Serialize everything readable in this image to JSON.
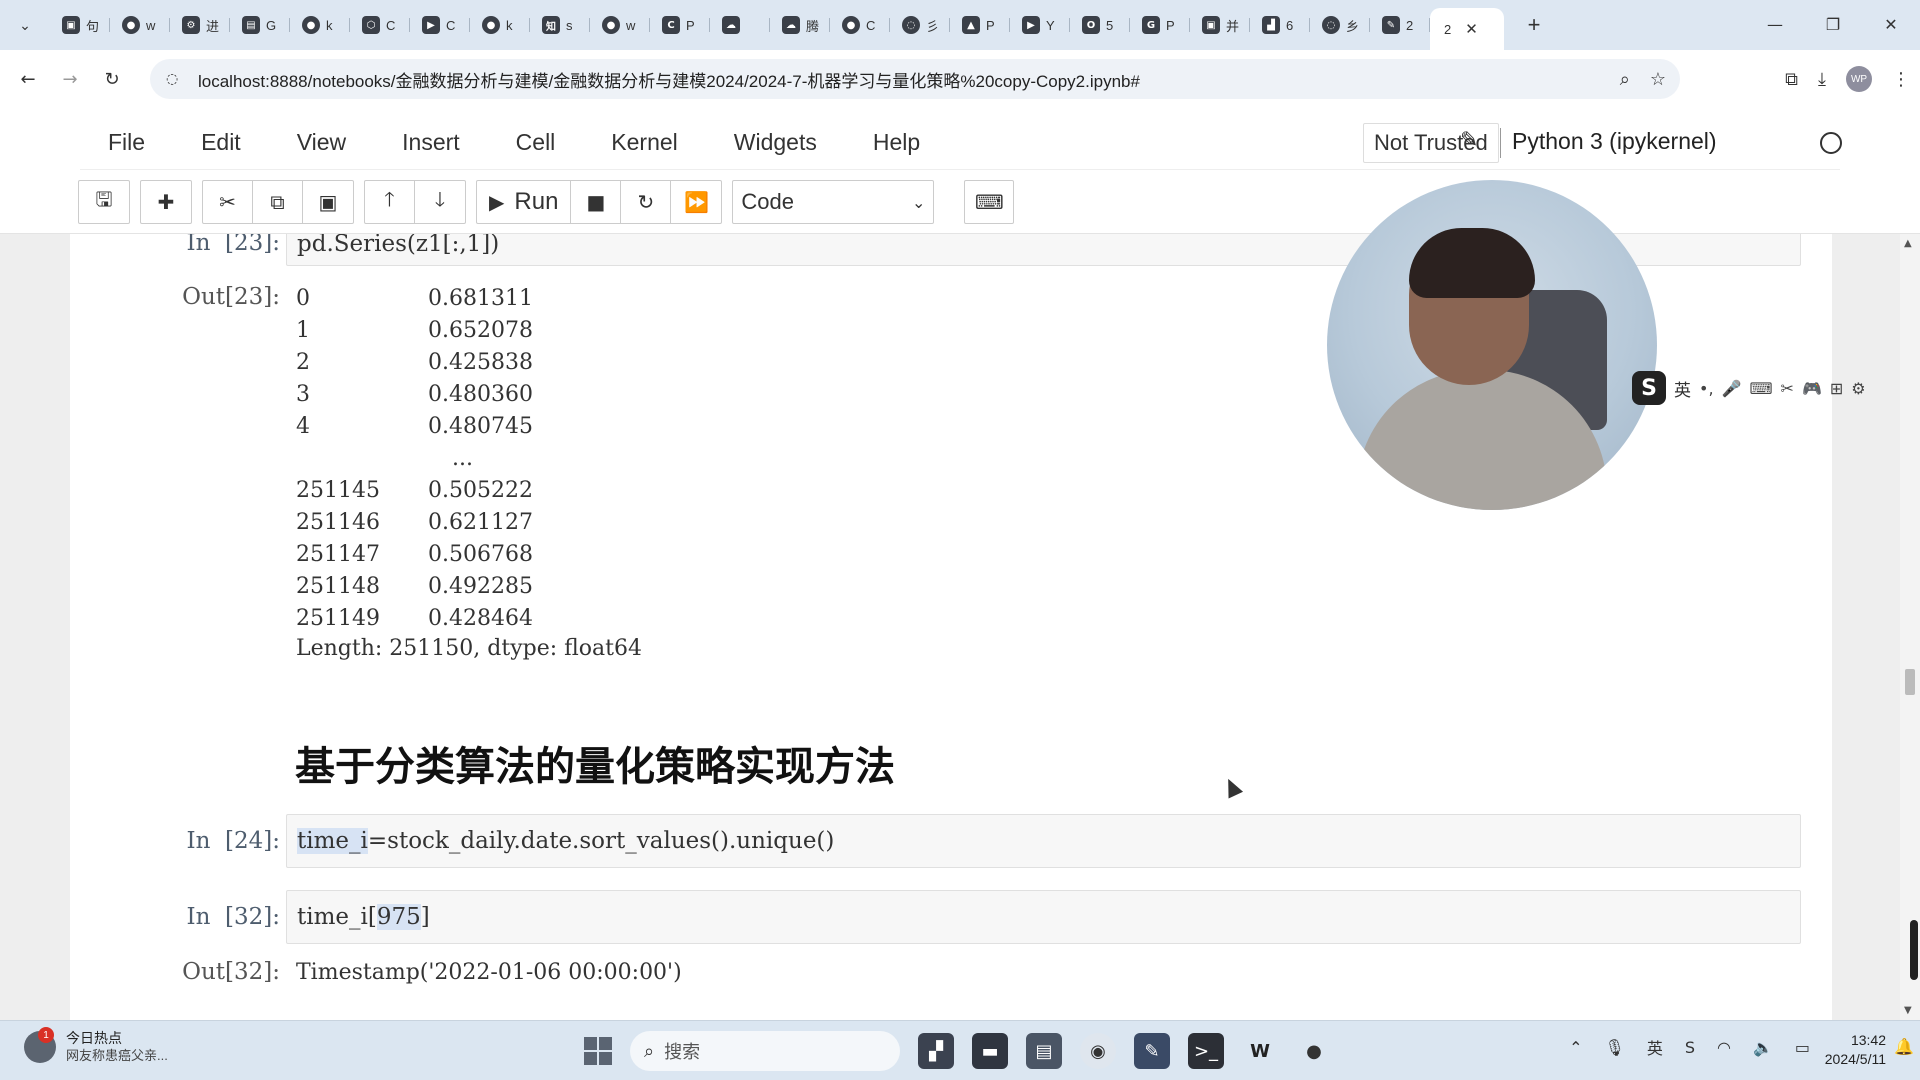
{
  "browser": {
    "tabs": [
      {
        "icon": "bili-icon",
        "glyph": "▣",
        "label": "句"
      },
      {
        "icon": "github-icon",
        "glyph": "●",
        "label": "w"
      },
      {
        "icon": "tool-icon",
        "glyph": "⚙",
        "label": "进"
      },
      {
        "icon": "doc-icon",
        "glyph": "▤",
        "label": "G"
      },
      {
        "icon": "github-icon",
        "glyph": "●",
        "label": "k"
      },
      {
        "icon": "cube-icon",
        "glyph": "⬡",
        "label": "C"
      },
      {
        "icon": "youtube-icon",
        "glyph": "▶",
        "label": "C"
      },
      {
        "icon": "github-icon",
        "glyph": "●",
        "label": "k"
      },
      {
        "icon": "zhihu-icon",
        "glyph": "知",
        "label": "s"
      },
      {
        "icon": "github-icon",
        "glyph": "●",
        "label": "w"
      },
      {
        "icon": "c-icon",
        "glyph": "C",
        "label": "P"
      },
      {
        "icon": "cloud-icon",
        "glyph": "☁",
        "label": ""
      },
      {
        "icon": "cloud-icon",
        "glyph": "☁",
        "label": "腾"
      },
      {
        "icon": "github-icon",
        "glyph": "●",
        "label": "C"
      },
      {
        "icon": "loading-icon",
        "glyph": "◌",
        "label": "彡"
      },
      {
        "icon": "cap-icon",
        "glyph": "▲",
        "label": "P"
      },
      {
        "icon": "youtube-icon",
        "glyph": "▶",
        "label": "Y"
      },
      {
        "icon": "o-icon",
        "glyph": "O",
        "label": "5"
      },
      {
        "icon": "google-icon",
        "glyph": "G",
        "label": "P"
      },
      {
        "icon": "bili-icon",
        "glyph": "▣",
        "label": "并"
      },
      {
        "icon": "chart-icon",
        "glyph": "▟",
        "label": "6"
      },
      {
        "icon": "loading-icon",
        "glyph": "◌",
        "label": "乡"
      },
      {
        "icon": "pen-icon",
        "glyph": "✎",
        "label": "2"
      }
    ],
    "active_tab": {
      "label": "2",
      "close": "✕"
    },
    "new_tab": "+",
    "window_controls": {
      "minimize": "—",
      "restore": "❐",
      "close": "✕"
    },
    "url": "localhost:8888/notebooks/金融数据分析与建模/金融数据分析与建模2024/2024-7-机器学习与量化策略%20copy-Copy2.ipynb#",
    "profile": "WP"
  },
  "jupyter": {
    "menu": [
      "File",
      "Edit",
      "View",
      "Insert",
      "Cell",
      "Kernel",
      "Widgets",
      "Help"
    ],
    "trust": "Not Trusted",
    "kernel": "Python 3 (ipykernel)",
    "toolbar": {
      "run_label": "Run",
      "cell_type": "Code"
    }
  },
  "cells": {
    "c23": {
      "in_prompt": "In  [23]:",
      "code": "pd.Series(z1[:,1])",
      "out_prompt": "Out[23]:",
      "rows": [
        {
          "idx": "0",
          "val": "0.681311"
        },
        {
          "idx": "1",
          "val": "0.652078"
        },
        {
          "idx": "2",
          "val": "0.425838"
        },
        {
          "idx": "3",
          "val": "0.480360"
        },
        {
          "idx": "4",
          "val": "0.480745"
        }
      ],
      "ellipsis": "...",
      "rows_tail": [
        {
          "idx": "251145",
          "val": "0.505222"
        },
        {
          "idx": "251146",
          "val": "0.621127"
        },
        {
          "idx": "251147",
          "val": "0.506768"
        },
        {
          "idx": "251148",
          "val": "0.492285"
        },
        {
          "idx": "251149",
          "val": "0.428464"
        }
      ],
      "footer": "Length: 251150, dtype: float64"
    },
    "heading": "基于分类算法的量化策略实现方法",
    "c24": {
      "in_prompt": "In  [24]:",
      "code_hl": "time_i",
      "code_rest": "=stock_daily.date.sort_values().unique()"
    },
    "c32": {
      "in_prompt": "In  [32]:",
      "code_a": "time_i[",
      "code_hl": "975",
      "code_b": "]",
      "out_prompt": "Out[32]:",
      "output": "Timestamp('2022-01-06 00:00:00')"
    }
  },
  "ime": {
    "lang": "英"
  },
  "taskbar": {
    "news_title": "今日热点",
    "news_sub": "网友称患癌父亲...",
    "news_badge": "1",
    "search_placeholder": "搜索",
    "time": "13:42",
    "date": "2024/5/11"
  },
  "colors": {
    "accent": "#337ab7",
    "code_bg": "#f7f7f7",
    "highlight": "#d7e3f4"
  }
}
